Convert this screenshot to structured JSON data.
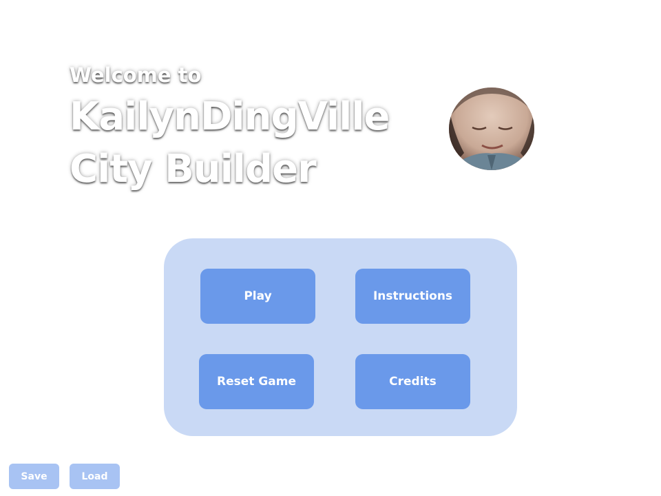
{
  "title": {
    "welcome": "Welcome to",
    "line1": "KailynDingVille",
    "line2": "City Builder"
  },
  "menu": {
    "play_label": "Play",
    "instructions_label": "Instructions",
    "reset_label": "Reset Game",
    "credits_label": "Credits"
  },
  "footer": {
    "save_label": "Save",
    "load_label": "Load"
  },
  "colors": {
    "background": "#ffffff",
    "panel": "#c9d9f5",
    "button": "#6a99ea",
    "small_button": "#a8c3f3",
    "title_text": "#ffffff"
  }
}
